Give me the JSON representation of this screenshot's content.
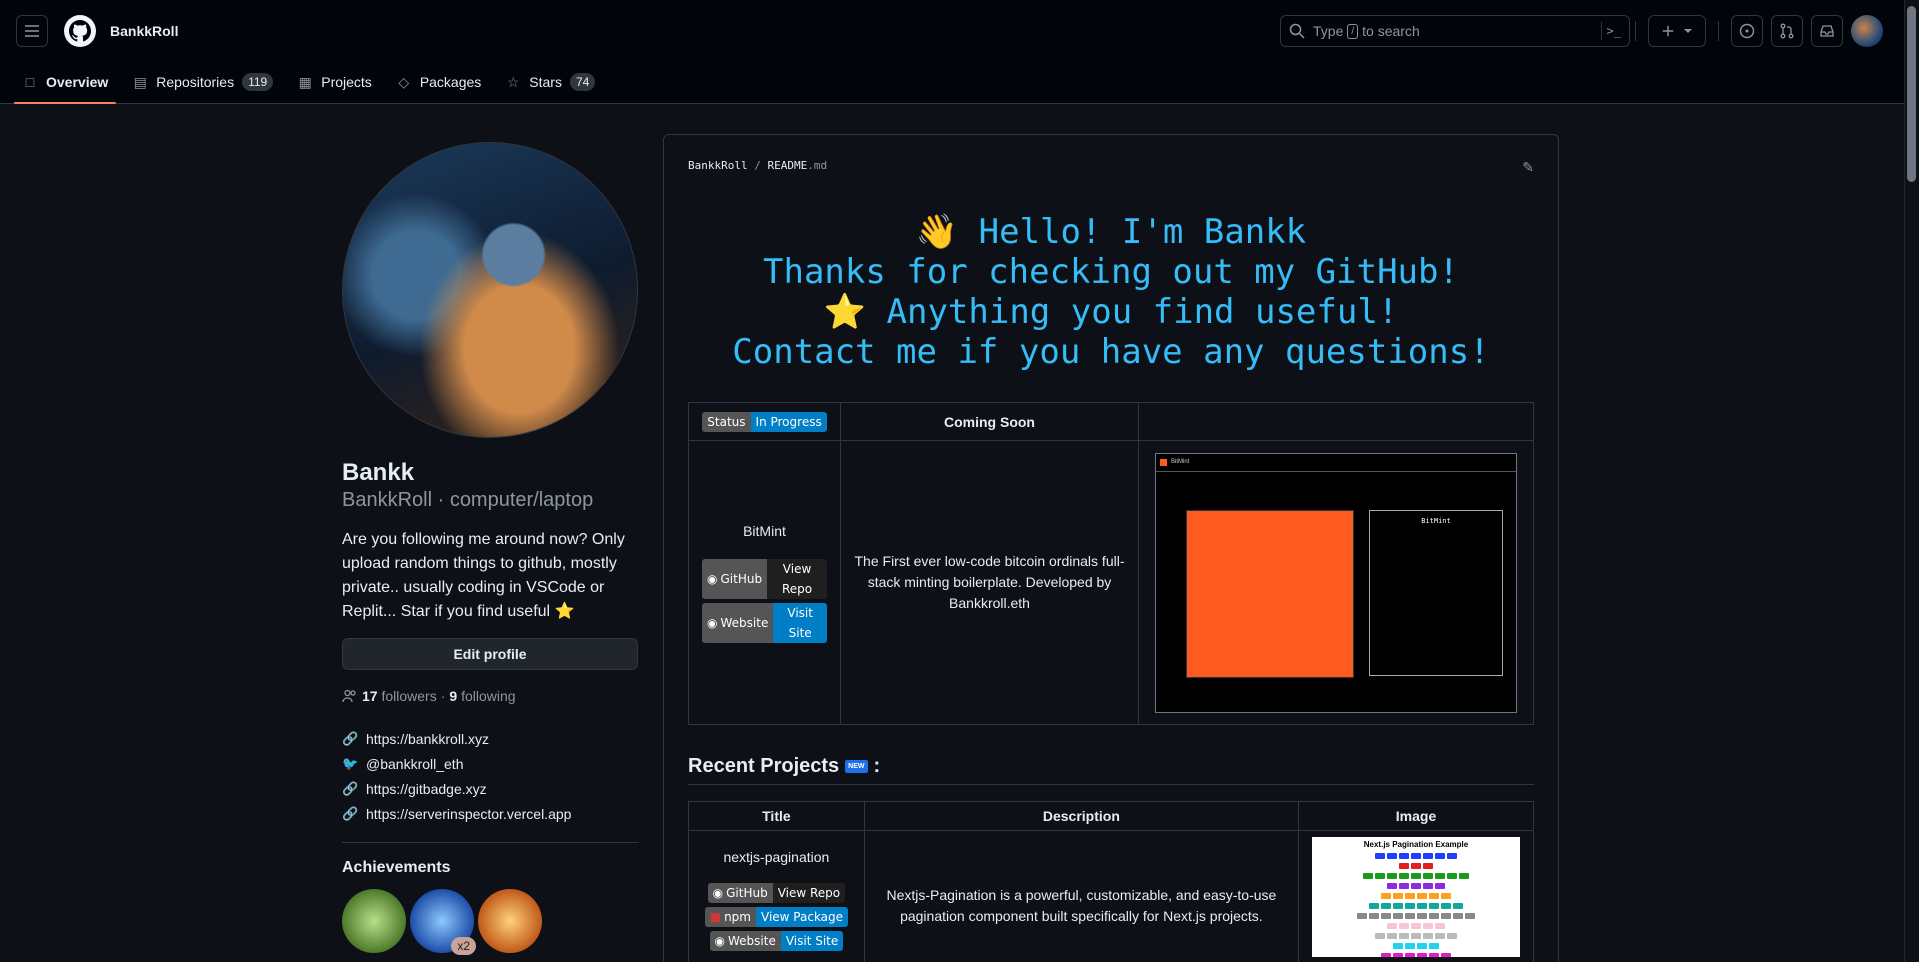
{
  "header": {
    "context": "BankkRoll",
    "search_prefix": "Type",
    "search_key": "/",
    "search_suffix": "to search",
    "command_icon": ">_"
  },
  "tabs": [
    {
      "label": "Overview",
      "icon": "book-icon"
    },
    {
      "label": "Repositories",
      "icon": "repo-icon",
      "count": "119"
    },
    {
      "label": "Projects",
      "icon": "table-icon"
    },
    {
      "label": "Packages",
      "icon": "package-icon"
    },
    {
      "label": "Stars",
      "icon": "star-icon",
      "count": "74"
    }
  ],
  "profile": {
    "name": "Bankk",
    "login": "BankkRoll · computer/laptop",
    "bio": "Are you following me around now? Only upload random things to github, mostly private.. usually coding in VSCode or Replit... Star if you find useful ⭐",
    "edit_label": "Edit profile",
    "followers": "17",
    "followers_label": "followers",
    "following": "9",
    "following_label": "following",
    "dot": "·",
    "links": [
      {
        "icon": "link-icon",
        "text": "https://bankkroll.xyz"
      },
      {
        "icon": "twitter-icon",
        "text": "@bankkroll_eth"
      },
      {
        "icon": "link-icon",
        "text": "https://gitbadge.xyz"
      },
      {
        "icon": "link-icon",
        "text": "https://serverinspector.vercel.app"
      }
    ],
    "achievements_title": "Achievements",
    "achievement_count": "x2"
  },
  "readme": {
    "path_owner": "BankkRoll",
    "path_sep": "/",
    "path_file": "README",
    "path_ext": ".md",
    "hero_lines": [
      "👋 Hello! I'm Bankk",
      "Thanks for checking out my GitHub!",
      "⭐ Anything you find useful!",
      "Contact me if you have any questions!"
    ],
    "table1": {
      "status_label": "Status",
      "status_value": "In Progress",
      "coming_soon": "Coming Soon",
      "project": "BitMint",
      "github_label": "GitHub",
      "github_value": "View Repo",
      "website_label": "Website",
      "website_value": "Visit Site",
      "description": "The First ever low-code bitcoin ordinals full-stack minting boilerplate. Developed by Bankkroll.eth",
      "shot_title": "BitMint"
    },
    "recent_title": "Recent Projects",
    "recent_badge": "NEW",
    "recent_colon": ":",
    "table2": {
      "headers": [
        "Title",
        "Description",
        "Image"
      ],
      "project": "nextjs-pagination",
      "github_label": "GitHub",
      "github_value": "View Repo",
      "npm_label": "npm",
      "npm_value": "View Package",
      "website_label": "Website",
      "website_value": "Visit Site",
      "description": "Nextjs-Pagination is a powerful, customizable, and easy-to-use pagination component built specifically for Next.js projects.",
      "image_title": "Next.js Pagination Example"
    }
  },
  "colors": {
    "bg": "#0d1117",
    "header_bg": "#010409",
    "accent": "#f78166",
    "hero_text": "#36bcf7",
    "border": "#30363d"
  }
}
